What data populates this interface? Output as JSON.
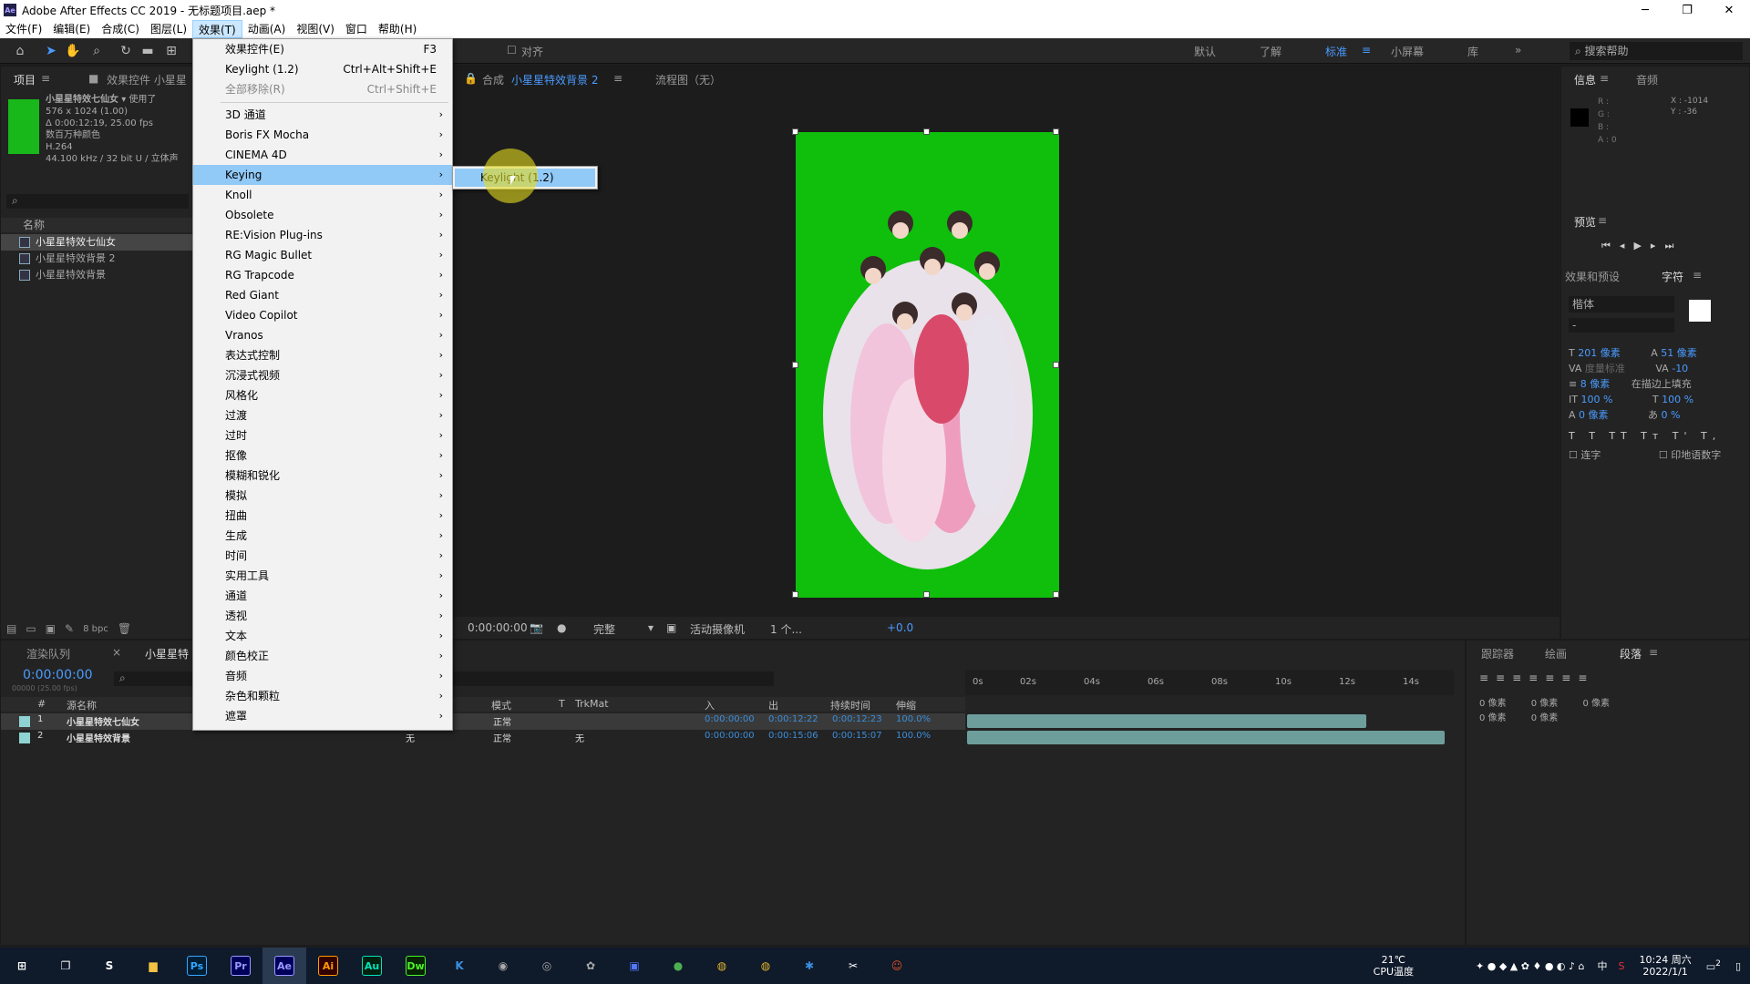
{
  "window": {
    "title": "Adobe After Effects CC 2019 - 无标题项目.aep *",
    "app_icon": "Ae"
  },
  "menubar": [
    "文件(F)",
    "编辑(E)",
    "合成(C)",
    "图层(L)",
    "效果(T)",
    "动画(A)",
    "视图(V)",
    "窗口",
    "帮助(H)"
  ],
  "menubar_active": "效果(T)",
  "toolbar": {
    "align": "对齐",
    "workspaces": [
      "默认",
      "了解",
      "标准",
      "小屏幕",
      "库"
    ],
    "active_workspace": "标准",
    "help_search": "搜索帮助"
  },
  "project": {
    "tab": "项目",
    "tab2": "效果控件 小星星",
    "item_name": "小星星特效七仙女",
    "used": "使用了",
    "dims": "576 x 1024 (1.00)",
    "duration": "Δ 0:00:12:19, 25.00 fps",
    "colors": "数百万种颜色",
    "codec": "H.264",
    "audio": "44.100 kHz / 32 bit U / 立体声",
    "col_name": "名称",
    "items": [
      "小星星特效七仙女",
      "小星星特效背景 2",
      "小星星特效背景"
    ],
    "bpc": "8 bpc"
  },
  "comp": {
    "tab_prefix": "合成",
    "tab_name": "小星星特效背景 2",
    "flow": "流程图（无）",
    "timecode": "0:00:00:00",
    "quality": "完整",
    "camera": "活动摄像机",
    "views": "1 个...",
    "exposure": "+0.0"
  },
  "effects_menu": {
    "items": [
      {
        "label": "效果控件(E)",
        "shortcut": "F3"
      },
      {
        "label": "Keylight (1.2)",
        "shortcut": "Ctrl+Alt+Shift+E"
      },
      {
        "label": "全部移除(R)",
        "shortcut": "Ctrl+Shift+E",
        "disabled": true
      },
      {
        "label": "3D 通道"
      },
      {
        "label": "Boris FX Mocha"
      },
      {
        "label": "CINEMA 4D"
      },
      {
        "label": "Keying",
        "hover": true
      },
      {
        "label": "Knoll"
      },
      {
        "label": "Obsolete"
      },
      {
        "label": "RE:Vision Plug-ins"
      },
      {
        "label": "RG Magic Bullet"
      },
      {
        "label": "RG Trapcode"
      },
      {
        "label": "Red Giant"
      },
      {
        "label": "Video Copilot"
      },
      {
        "label": "Vranos"
      },
      {
        "label": "表达式控制"
      },
      {
        "label": "沉浸式视频"
      },
      {
        "label": "风格化"
      },
      {
        "label": "过渡"
      },
      {
        "label": "过时"
      },
      {
        "label": "抠像"
      },
      {
        "label": "模糊和锐化"
      },
      {
        "label": "模拟"
      },
      {
        "label": "扭曲"
      },
      {
        "label": "生成"
      },
      {
        "label": "时间"
      },
      {
        "label": "实用工具"
      },
      {
        "label": "通道"
      },
      {
        "label": "透视"
      },
      {
        "label": "文本"
      },
      {
        "label": "颜色校正"
      },
      {
        "label": "音频"
      },
      {
        "label": "杂色和颗粒"
      },
      {
        "label": "遮罩"
      }
    ],
    "submenu": "Keylight (1.2)"
  },
  "info": {
    "tab": "信息",
    "tab2": "音频",
    "rgba": [
      "R :",
      "G :",
      "B :",
      "A : 0"
    ],
    "x": "X : -1014",
    "y": "Y : -36"
  },
  "preview": {
    "tab": "预览"
  },
  "effects_presets": {
    "tab": "效果和预设",
    "tab2": "字符"
  },
  "character": {
    "font": "楷体",
    "style": "-",
    "size": "201 像素",
    "leading": "51 像素",
    "kern": "度量标准",
    "track": "-10",
    "stroke": "8 像素",
    "stroke_mode": "在描边上填充",
    "vscale": "100 %",
    "hscale": "100 %",
    "baseline": "0 像素",
    "tsume": "0 %",
    "ligature": "连字",
    "hindi": "印地语数字"
  },
  "timeline": {
    "tab1": "渲染队列",
    "tab2": "小星星特",
    "timecode": "0:00:00:00",
    "fps": "00000 (25.00 fps)",
    "headers": [
      "#",
      "源名称",
      "模式",
      "T",
      "TrkMat",
      "入",
      "出",
      "持续时间",
      "伸缩"
    ],
    "rows": [
      {
        "num": "1",
        "name": "小星星特效七仙女",
        "mode": "正常",
        "trkmat": "",
        "in": "0:00:00:00",
        "out": "0:00:12:22",
        "dur": "0:00:12:23",
        "stretch": "100.0%"
      },
      {
        "num": "2",
        "name": "小星星特效背景",
        "parent": "无",
        "mode": "正常",
        "trkmat": "无",
        "in": "0:00:00:00",
        "out": "0:00:15:06",
        "dur": "0:00:15:07",
        "stretch": "100.0%"
      }
    ],
    "ruler": [
      "0s",
      "02s",
      "04s",
      "06s",
      "08s",
      "10s",
      "12s",
      "14s"
    ]
  },
  "paragraph": {
    "tabs": [
      "跟踪器",
      "绘画",
      "段落"
    ],
    "active": "段落",
    "indent": [
      "0 像素",
      "0 像素",
      "0 像素",
      "0 像素",
      "0 像素"
    ]
  },
  "taskbar": {
    "apps": [
      "Ps",
      "Pr",
      "Ae",
      "Ai",
      "Au",
      "Dw"
    ],
    "weather": "21℃",
    "cpu": "CPU温度",
    "time": "10:24 周六",
    "date": "2022/1/1",
    "notif": "2",
    "ime": "中"
  }
}
